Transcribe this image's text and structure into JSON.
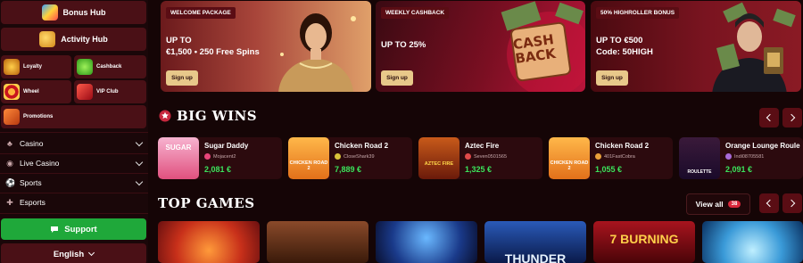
{
  "sidebar": {
    "bonus_hub": "Bonus Hub",
    "activity_hub": "Activity Hub",
    "promo_items": [
      {
        "label": "Loyalty",
        "icon": "crown-icon"
      },
      {
        "label": "Cashback",
        "icon": "clover-icon"
      },
      {
        "label": "Wheel",
        "icon": "wheel-icon"
      },
      {
        "label": "VIP Club",
        "icon": "diamond-icon"
      },
      {
        "label": "Promotions",
        "icon": "gift-icon"
      }
    ],
    "nav": [
      {
        "label": "Casino",
        "icon": "cherries-icon"
      },
      {
        "label": "Live Casino",
        "icon": "live-icon"
      },
      {
        "label": "Sports",
        "icon": "ball-icon"
      },
      {
        "label": "Esports",
        "icon": "gamepad-icon"
      }
    ],
    "support": "Support",
    "language": "English"
  },
  "banners": [
    {
      "tag": "WELCOME PACKAGE",
      "line1": "UP TO",
      "line2": "€1,500 • 250 Free Spins",
      "cta": "Sign up"
    },
    {
      "tag": "WEEKLY CASHBACK",
      "line1": "UP TO 25%",
      "line2": "",
      "cta": "Sign up",
      "art_text": "CASH BACK"
    },
    {
      "tag": "50% HIGHROLLER BONUS",
      "line1": "UP TO €500",
      "line2": "Code: 50HIGH",
      "cta": "Sign up"
    }
  ],
  "big_wins": {
    "title": "BIG WINS",
    "items": [
      {
        "game": "Sugar Daddy",
        "user": "Mojacent2",
        "amount": "2,081 €",
        "thumb_text": "SUGAR"
      },
      {
        "game": "Chicken Road 2",
        "user": "CloseShark39",
        "amount": "7,889 €",
        "thumb_text": "CHICKEN ROAD 2"
      },
      {
        "game": "Aztec Fire",
        "user": "Seven0501565",
        "amount": "1,325 €",
        "thumb_text": "AZTEC FIRE"
      },
      {
        "game": "Chicken Road 2",
        "user": "401FastCobra",
        "amount": "1,055 €",
        "thumb_text": "CHICKEN ROAD 2"
      },
      {
        "game": "Orange Lounge Roule",
        "user": "Indi08705581",
        "amount": "2,091 €",
        "thumb_text": "ROULETTE"
      }
    ]
  },
  "top_games": {
    "title": "TOP GAMES",
    "view_all": "View all",
    "count": "38",
    "tile_texts": [
      "",
      "",
      "",
      "THUNDER",
      "7 BURNING",
      ""
    ]
  },
  "colors": {
    "accent_green": "#3be35b",
    "support_green": "#1fa83a",
    "panel": "#4a1016",
    "badge_red": "#d8263a"
  }
}
